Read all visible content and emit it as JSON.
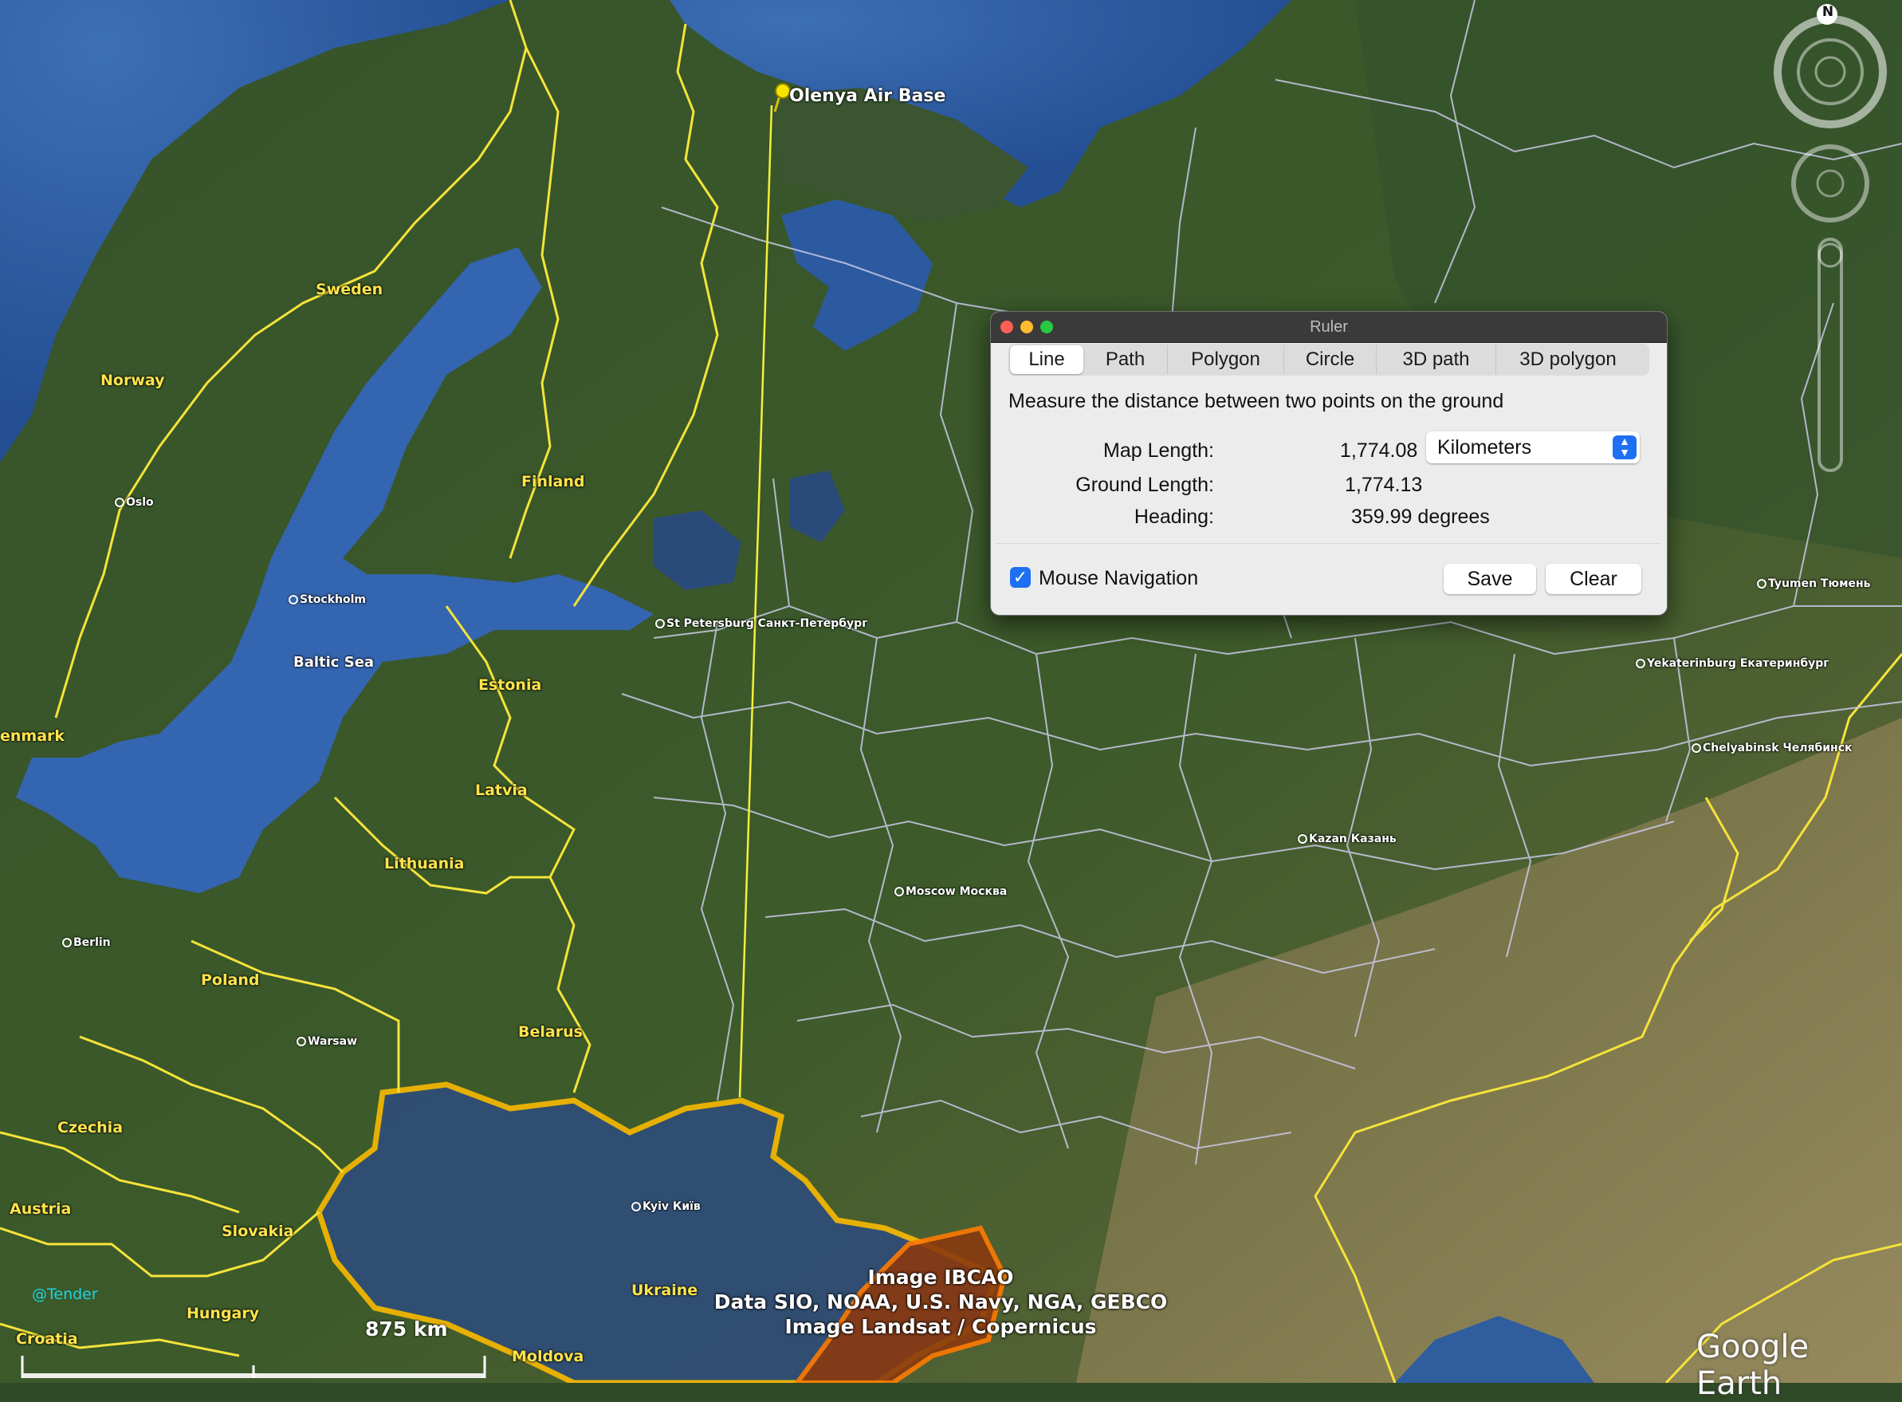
{
  "placemark": {
    "label": "Olenya Air Base"
  },
  "countries": [
    {
      "name": "Sweden"
    },
    {
      "name": "Norway"
    },
    {
      "name": "Finland"
    },
    {
      "name": "Estonia"
    },
    {
      "name": "Latvia"
    },
    {
      "name": "Lithuania"
    },
    {
      "name": "Poland"
    },
    {
      "name": "Belarus"
    },
    {
      "name": "Czechia"
    },
    {
      "name": "Austria"
    },
    {
      "name": "Slovakia"
    },
    {
      "name": "Hungary"
    },
    {
      "name": "Croatia"
    },
    {
      "name": "Ukraine"
    },
    {
      "name": "Moldova"
    },
    {
      "name": "enmark"
    }
  ],
  "cities": [
    {
      "name": "Oslo"
    },
    {
      "name": "Stockholm"
    },
    {
      "name": "St Petersburg Санкт-Петербург"
    },
    {
      "name": "Moscow Москва"
    },
    {
      "name": "Kazan Казань"
    },
    {
      "name": "Berlin"
    },
    {
      "name": "Warsaw"
    },
    {
      "name": "Kyiv Київ"
    },
    {
      "name": "Tyumen Тюмень"
    },
    {
      "name": "Yekaterinburg Екатеринбург"
    },
    {
      "name": "Chelyabinsk Челябинск"
    }
  ],
  "seas": [
    {
      "name": "Baltic Sea"
    }
  ],
  "credits": {
    "line1": "Image IBCAO",
    "line2": "Data SIO, NOAA, U.S. Navy, NGA, GEBCO",
    "line3": "Image Landsat / Copernicus"
  },
  "scale": {
    "label": "875 km"
  },
  "watermark": "Google Earth",
  "user_tag": "@Tender",
  "compass": {
    "north": "N"
  },
  "ruler": {
    "title": "Ruler",
    "tabs": [
      "Line",
      "Path",
      "Polygon",
      "Circle",
      "3D path",
      "3D polygon"
    ],
    "active_tab": "Line",
    "description": "Measure the distance between two points on the ground",
    "map_length_label": "Map Length:",
    "map_length_value": "1,774.08",
    "units": "Kilometers",
    "ground_length_label": "Ground Length:",
    "ground_length_value": "1,774.13",
    "heading_label": "Heading:",
    "heading_value": "359.99 degrees",
    "mouse_nav_label": "Mouse Navigation",
    "mouse_nav_checked": true,
    "save_label": "Save",
    "clear_label": "Clear"
  },
  "colors": {
    "border_international": "#f5e33a",
    "border_regional": "#c9c9e6",
    "ukraine_highlight": "#f5b800",
    "ruler_line": "#f5ef3a",
    "accent": "#1f6ff2"
  }
}
